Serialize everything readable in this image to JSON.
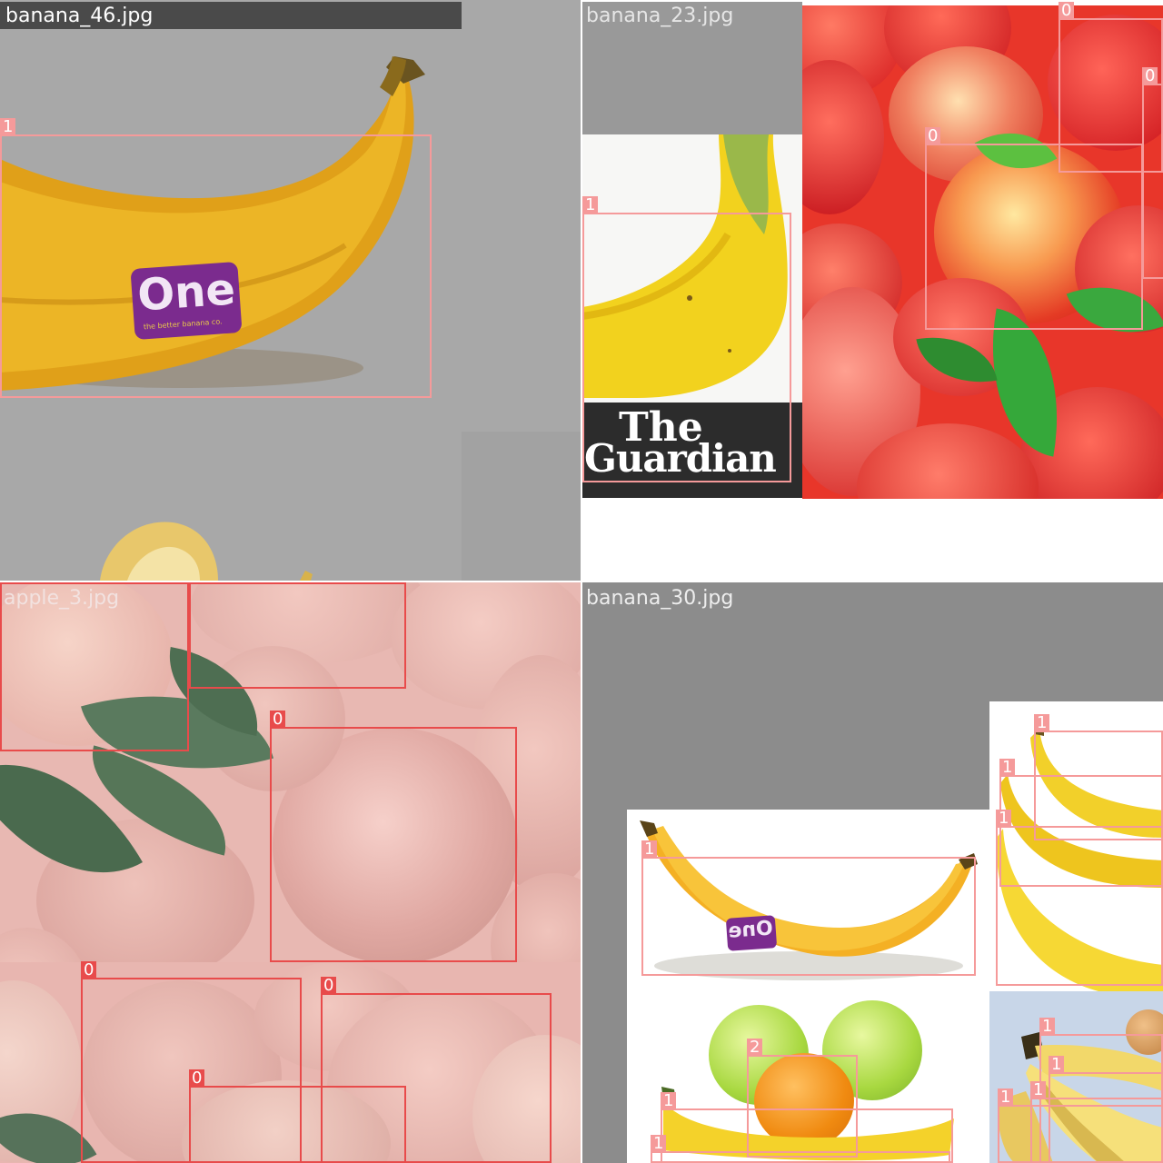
{
  "tiles": {
    "top_left": {
      "filename": "banana_46.jpg",
      "sticker_text": "One",
      "sticker_subtext": "the better banana co.",
      "boxes": [
        {
          "label": "1"
        }
      ]
    },
    "top_right": {
      "filename": "banana_23.jpg",
      "logo_line1": "The",
      "logo_line2": "Guardian",
      "boxes": [
        {
          "label": "1"
        },
        {
          "label": "0"
        },
        {
          "label": "0"
        },
        {
          "label": "0"
        }
      ]
    },
    "bottom_left": {
      "filename": "apple_3.jpg",
      "boxes": [
        {
          "label": "0"
        },
        {
          "label": "0"
        },
        {
          "label": "0"
        },
        {
          "label": "0"
        },
        {
          "label": "0"
        },
        {
          "label": "0"
        }
      ]
    },
    "bottom_right": {
      "filename": "banana_30.jpg",
      "sticker_text": "One",
      "boxes": [
        {
          "label": "1"
        },
        {
          "label": "1"
        },
        {
          "label": "1"
        },
        {
          "label": "1"
        },
        {
          "label": "2"
        },
        {
          "label": "1"
        },
        {
          "label": "1"
        },
        {
          "label": "1"
        },
        {
          "label": "1"
        },
        {
          "label": "1"
        },
        {
          "label": "1"
        }
      ]
    }
  },
  "colors": {
    "box_light": "#f59a9a",
    "box_red": "#e84b4b",
    "label_bar": "#4a4a4a",
    "gray_bg": "#8c8c8c"
  }
}
